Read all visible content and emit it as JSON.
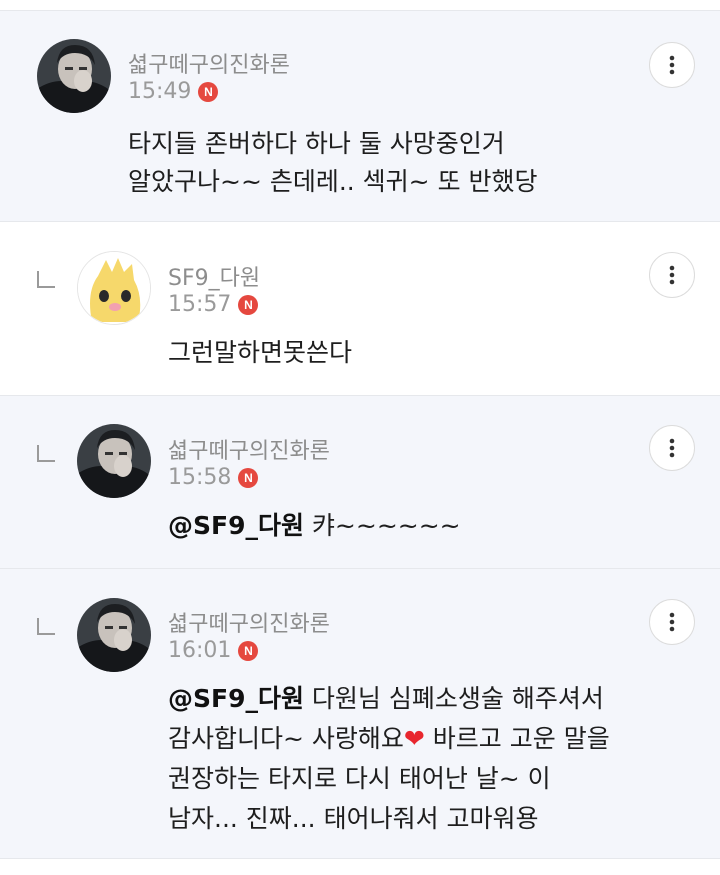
{
  "comments": [
    {
      "nickname": "셟구떼구의진화론",
      "time": "15:49",
      "badge": "N",
      "text": "타지들 존버하다 하나 둘 사망중인거\n알았구나~~ 츤데레.. 섹귀~ 또 반했당"
    },
    {
      "nickname": "SF9_다원",
      "time": "15:57",
      "badge": "N",
      "text": "그런말하면못쓴다"
    },
    {
      "nickname": "셟구떼구의진화론",
      "time": "15:58",
      "badge": "N",
      "mention": "@SF9_다원",
      "text": " 캬~~~~~~"
    },
    {
      "nickname": "셟구떼구의진화론",
      "time": "16:01",
      "badge": "N",
      "mention": "@SF9_다원",
      "text_part1": " 다원님 심폐소생술 해주셔서\n감사합니다~ 사랑해요",
      "heart": "❤",
      "text_part2": " 바르고 고운 말을\n권장하는 타지로 다시 태어난 날~ 이\n남자... 진짜... 태어나줘서 고마워용"
    }
  ],
  "colors": {
    "highlight_bg": "#f4f6fb",
    "badge": "#e5483f",
    "heart": "#e8262e"
  },
  "icons": {
    "more": "more-vertical-icon",
    "reply": "reply-arrow-icon"
  }
}
